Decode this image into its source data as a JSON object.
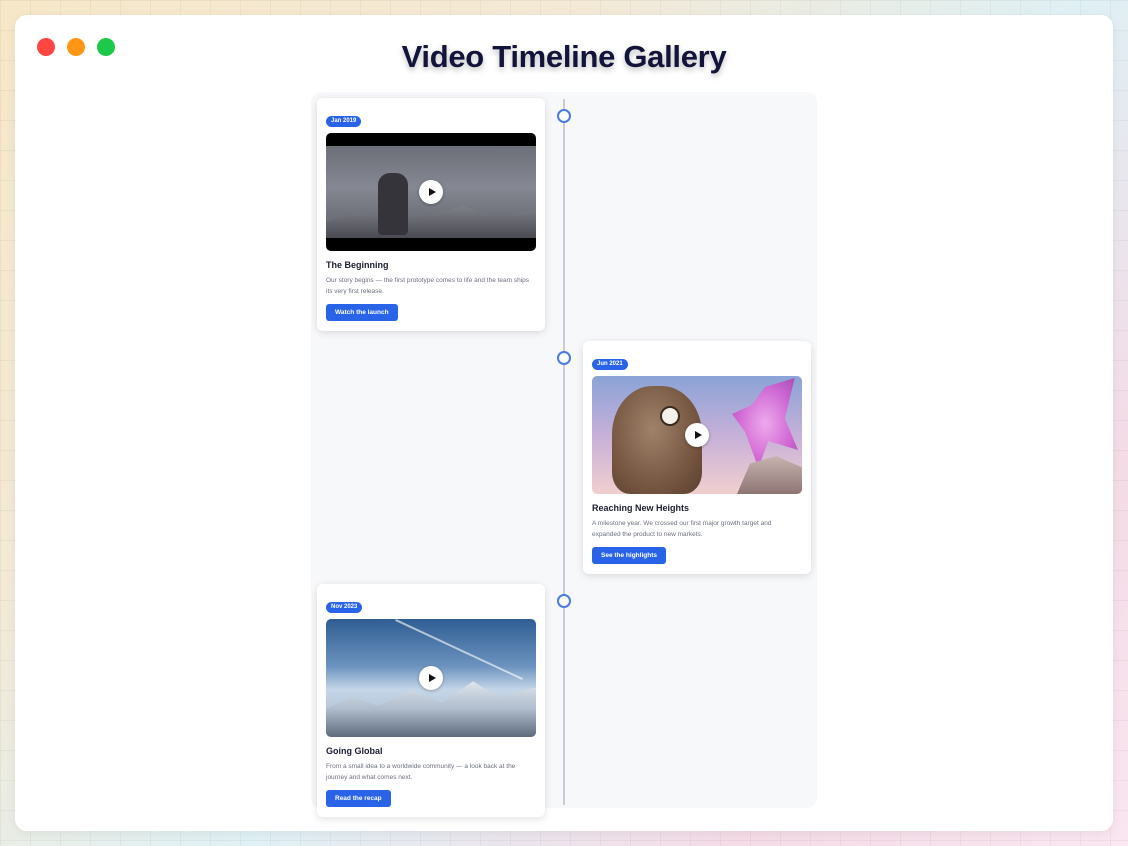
{
  "window": {
    "title": "Video Timeline Gallery"
  },
  "timeline": {
    "items": [
      {
        "date": "Jan 2019",
        "title": "The Beginning",
        "description": "Our story begins — the first prototype comes to life and the team ships its very first release.",
        "cta": "Watch the launch",
        "side": "left"
      },
      {
        "date": "Jun 2021",
        "title": "Reaching New Heights",
        "description": "A milestone year. We crossed our first major growth target and expanded the product to new markets.",
        "cta": "See the highlights",
        "side": "right"
      },
      {
        "date": "Nov 2023",
        "title": "Going Global",
        "description": "From a small idea to a worldwide community — a look back at the journey and what comes next.",
        "cta": "Read the recap",
        "side": "left"
      }
    ]
  },
  "colors": {
    "accent": "#2863e8",
    "marker": "#4a7be0",
    "title": "#12143a"
  }
}
